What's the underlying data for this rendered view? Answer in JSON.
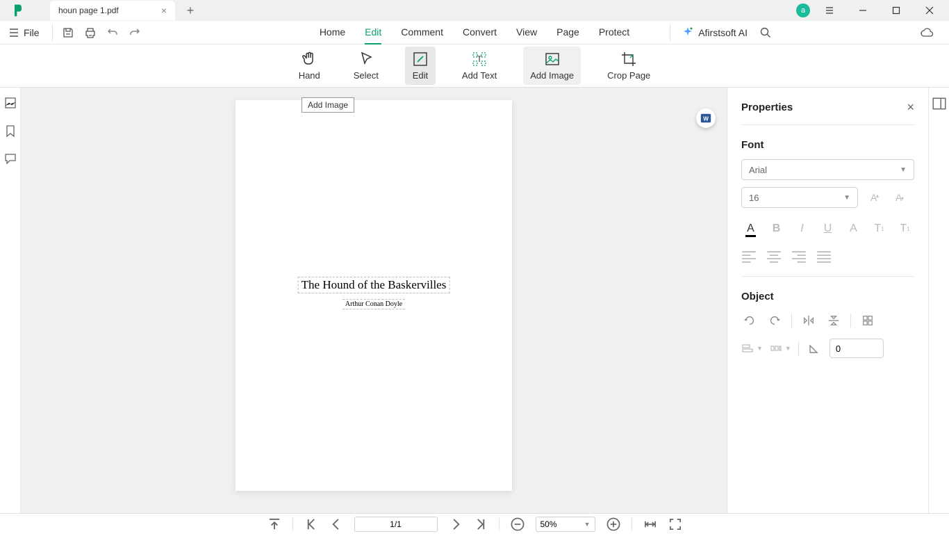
{
  "titlebar": {
    "tab_name": "houn page 1.pdf",
    "user_initial": "a"
  },
  "file_menu_label": "File",
  "menu_tabs": [
    "Home",
    "Edit",
    "Comment",
    "Convert",
    "View",
    "Page",
    "Protect"
  ],
  "active_menu_tab": "Edit",
  "ai_label": "Afirstsoft AI",
  "toolbar": {
    "hand": "Hand",
    "select": "Select",
    "edit": "Edit",
    "add_text": "Add Text",
    "add_image": "Add Image",
    "crop_page": "Crop Page"
  },
  "tooltip_text": "Add Image",
  "document": {
    "title": "The Hound of the Baskervilles",
    "author": "Arthur Conan Doyle"
  },
  "properties": {
    "panel_title": "Properties",
    "font_section": "Font",
    "font_family": "Arial",
    "font_size": "16",
    "object_section": "Object",
    "rotation": "0"
  },
  "bottombar": {
    "page_display": "1/1",
    "zoom": "50%"
  }
}
